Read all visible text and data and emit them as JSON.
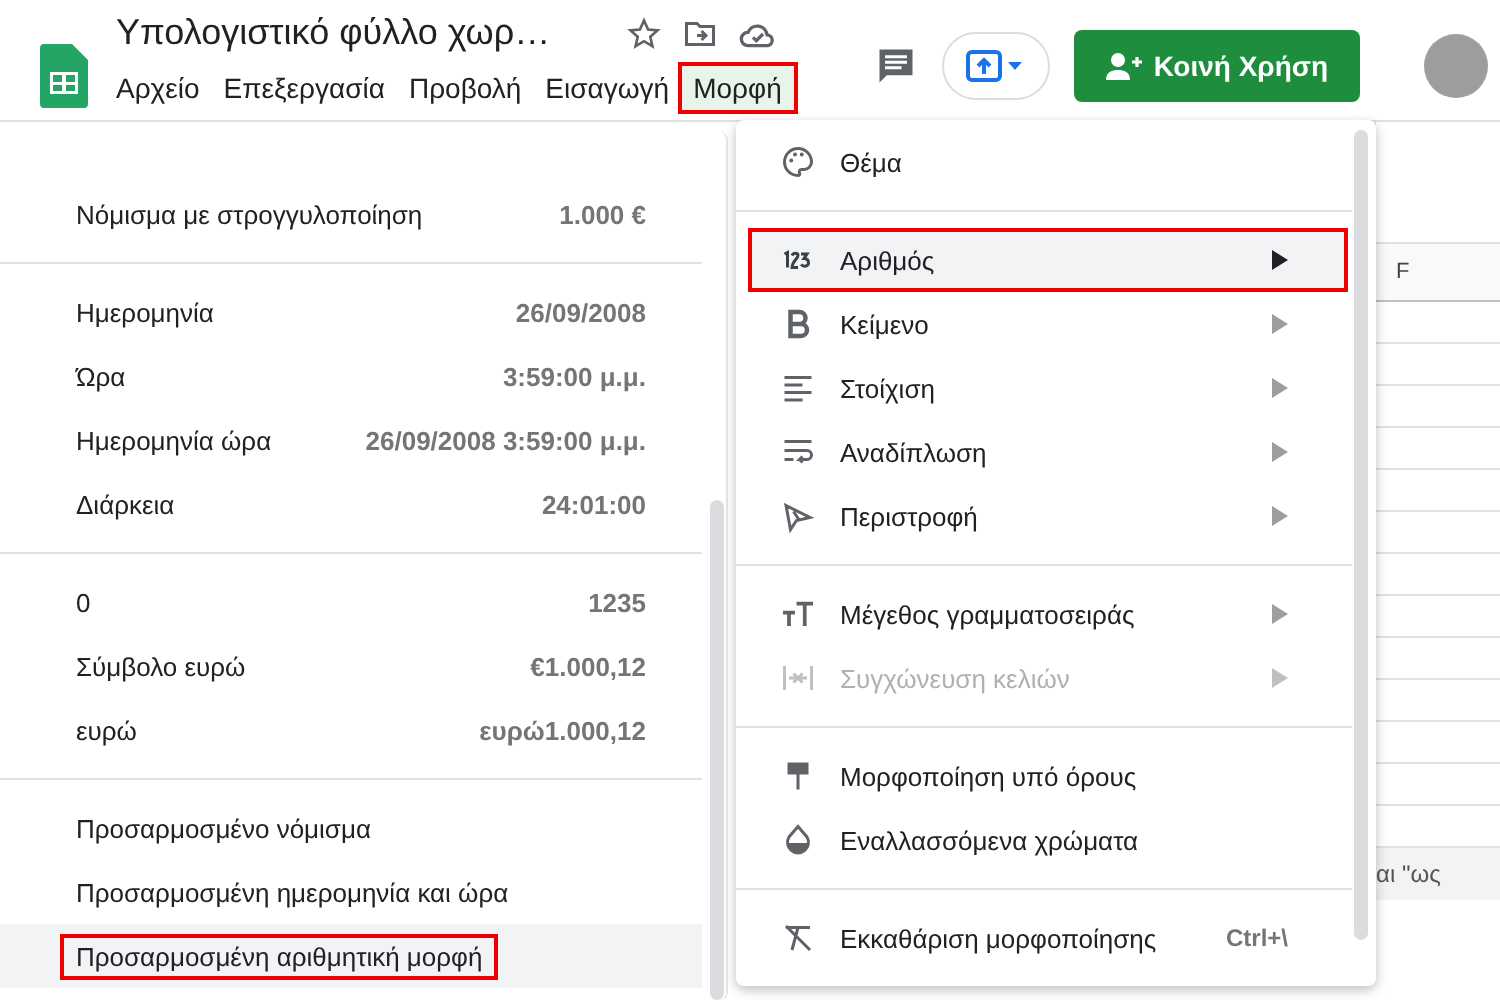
{
  "document": {
    "title": "Υπολογιστικό φύλλο χωρ…"
  },
  "menubar": [
    {
      "label": "Αρχείο",
      "selected": false,
      "outlined": false
    },
    {
      "label": "Επεξεργασία",
      "selected": false,
      "outlined": false
    },
    {
      "label": "Προβολή",
      "selected": false,
      "outlined": false
    },
    {
      "label": "Εισαγωγή",
      "selected": false,
      "outlined": false
    },
    {
      "label": "Μορφή",
      "selected": true,
      "outlined": true
    }
  ],
  "share_button": {
    "label": "Κοινή Χρήση"
  },
  "grid": {
    "column_header": "F",
    "cell_text": "αι \"ως"
  },
  "number_submenu": {
    "sections": [
      [
        {
          "label": "Νόμισμα με στρογγυλοποίηση",
          "example": "1.000 €",
          "hovered": false,
          "outlined": false
        }
      ],
      [
        {
          "label": "Ημερομηνία",
          "example": "26/09/2008",
          "hovered": false,
          "outlined": false
        },
        {
          "label": "Ώρα",
          "example": "3:59:00 μ.μ.",
          "hovered": false,
          "outlined": false
        },
        {
          "label": "Ημερομηνία ώρα",
          "example": "26/09/2008 3:59:00 μ.μ.",
          "hovered": false,
          "outlined": false
        },
        {
          "label": "Διάρκεια",
          "example": "24:01:00",
          "hovered": false,
          "outlined": false
        }
      ],
      [
        {
          "label": "0",
          "example": "1235",
          "hovered": false,
          "outlined": false
        },
        {
          "label": "Σύμβολο ευρώ",
          "example": "€1.000,12",
          "hovered": false,
          "outlined": false
        },
        {
          "label": "ευρώ",
          "example": "ευρώ1.000,12",
          "hovered": false,
          "outlined": false
        }
      ],
      [
        {
          "label": "Προσαρμοσμένο νόμισμα",
          "hovered": false,
          "outlined": false
        },
        {
          "label": "Προσαρμοσμένη ημερομηνία και ώρα",
          "hovered": false,
          "outlined": false
        },
        {
          "label": "Προσαρμοσμένη αριθμητική μορφή",
          "hovered": true,
          "outlined": true
        }
      ]
    ]
  },
  "format_menu": {
    "sections": [
      [
        {
          "kind": "palette",
          "label": "Θέμα",
          "submenu": false,
          "disabled": false,
          "hovered": false,
          "outlined": false
        }
      ],
      [
        {
          "kind": "number",
          "label": "Αριθμός",
          "submenu": true,
          "disabled": false,
          "hovered": true,
          "outlined": true
        },
        {
          "kind": "bold",
          "label": "Κείμενο",
          "submenu": true,
          "disabled": false,
          "hovered": false,
          "outlined": false
        },
        {
          "kind": "align",
          "label": "Στοίχιση",
          "submenu": true,
          "disabled": false,
          "hovered": false,
          "outlined": false
        },
        {
          "kind": "wrap",
          "label": "Αναδίπλωση",
          "submenu": true,
          "disabled": false,
          "hovered": false,
          "outlined": false
        },
        {
          "kind": "rotate",
          "label": "Περιστροφή",
          "submenu": true,
          "disabled": false,
          "hovered": false,
          "outlined": false
        }
      ],
      [
        {
          "kind": "size",
          "label": "Μέγεθος γραμματοσειράς",
          "submenu": true,
          "disabled": false,
          "hovered": false,
          "outlined": false
        },
        {
          "kind": "merge",
          "label": "Συγχώνευση κελιών",
          "submenu": true,
          "disabled": true,
          "hovered": false,
          "outlined": false
        }
      ],
      [
        {
          "kind": "paint",
          "label": "Μορφοποίηση υπό όρους",
          "submenu": false,
          "disabled": false,
          "hovered": false,
          "outlined": false
        },
        {
          "kind": "drop",
          "label": "Εναλλασσόμενα χρώματα",
          "submenu": false,
          "disabled": false,
          "hovered": false,
          "outlined": false
        }
      ],
      [
        {
          "kind": "clear",
          "label": "Εκκαθάριση μορφοποίησης",
          "shortcut": "Ctrl+\\",
          "submenu": false,
          "disabled": false,
          "hovered": false,
          "outlined": false
        }
      ]
    ]
  }
}
